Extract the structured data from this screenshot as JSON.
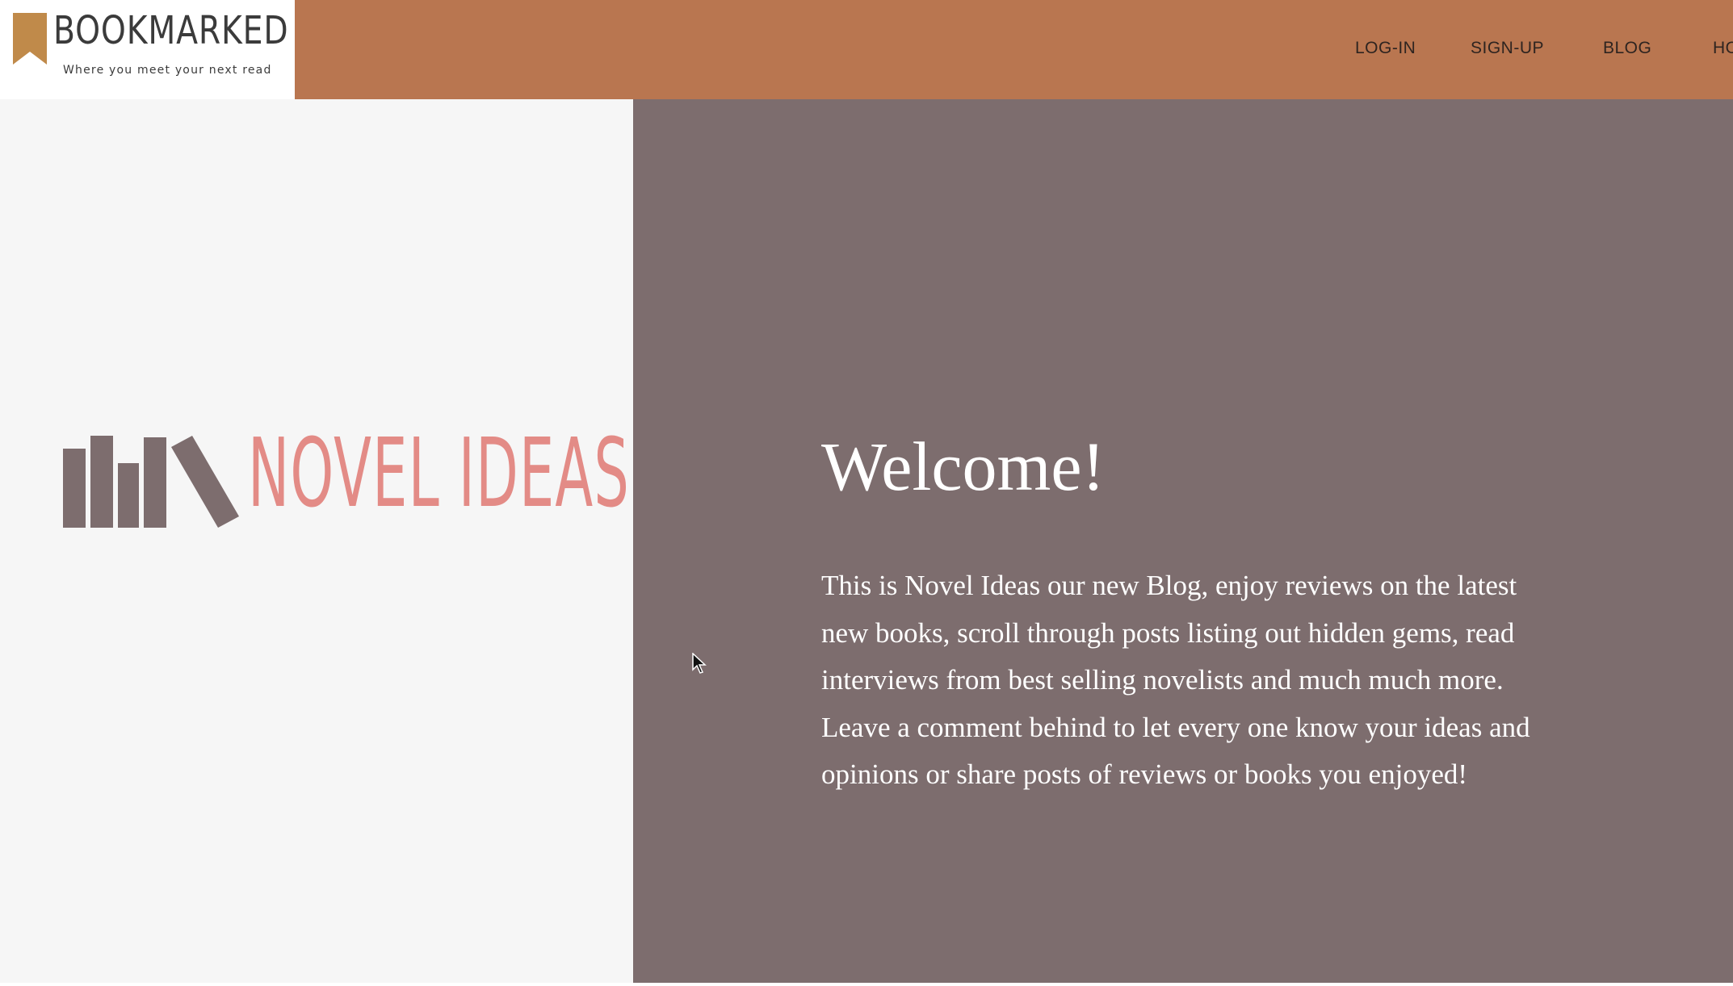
{
  "brand": {
    "name": "BOOKMARKED",
    "tagline": "Where you meet your next read",
    "accent_color": "#c08a4a"
  },
  "header": {
    "background_color": "#b97650"
  },
  "nav": {
    "items": [
      {
        "label": "LOG-IN"
      },
      {
        "label": "SIGN-UP"
      },
      {
        "label": "BLOG"
      },
      {
        "label": "HO"
      }
    ]
  },
  "hero": {
    "logo_text": "NOVEL IDEAS",
    "logo_icon": "bookshelf-icon",
    "logo_text_color": "#e38b86",
    "logo_icon_color": "#7d6d6e",
    "title": "Welcome!",
    "lines": [
      "This is Novel Ideas our new Blog, enjoy reviews on the latest",
      "new books, scroll through posts listing out hidden gems, read",
      "interviews from best selling novelists and much much more.",
      "Leave a comment behind to let every one know your ideas and",
      "opinions or share posts of reviews or books you enjoyed!"
    ],
    "panel_color": "#7d6d6e"
  }
}
